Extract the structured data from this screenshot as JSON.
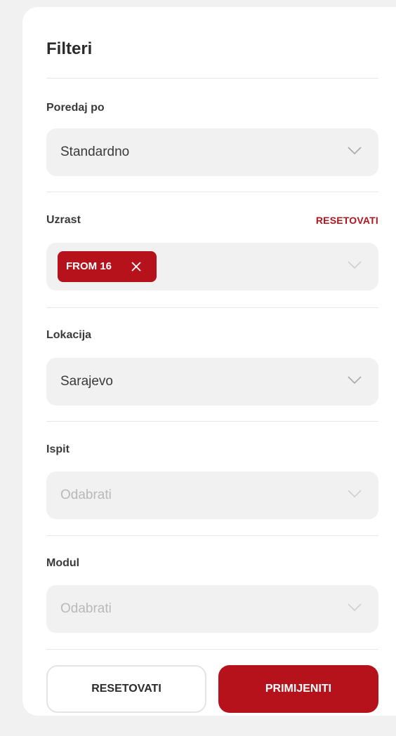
{
  "title": "Filteri",
  "sort": {
    "label": "Poredaj po",
    "value": "Standardno"
  },
  "age": {
    "label": "Uzrast",
    "reset_label": "RESETOVATI",
    "chip_label": "FROM 16",
    "chip_remove_icon": "close-icon"
  },
  "location": {
    "label": "Lokacija",
    "value": "Sarajevo"
  },
  "exam": {
    "label": "Ispit",
    "placeholder": "Odabrati"
  },
  "module": {
    "label": "Modul",
    "placeholder": "Odabrati"
  },
  "buttons": {
    "reset_label": "RESETOVATI",
    "apply_label": "PRIMIJENITI"
  },
  "colors": {
    "accent": "#b5121b",
    "field_bg": "#f1f1f1",
    "placeholder": "#b9b9b9"
  }
}
